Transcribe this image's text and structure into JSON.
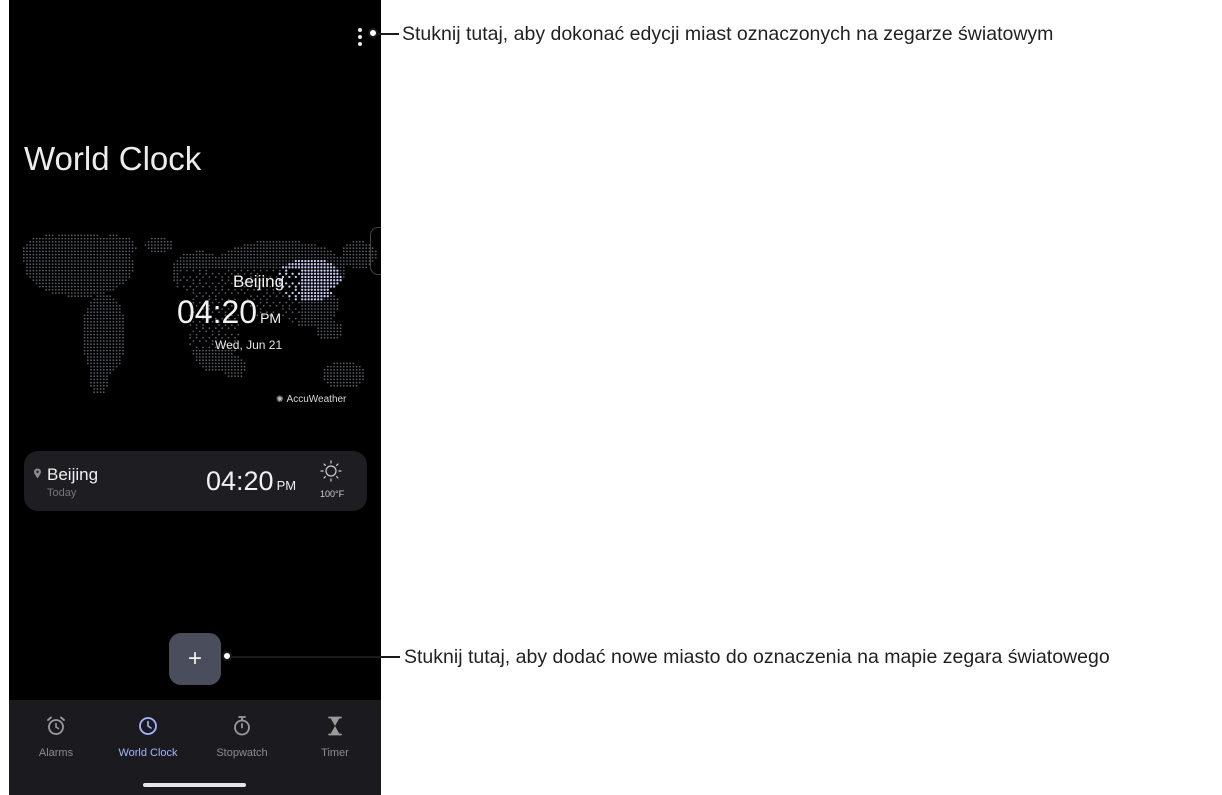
{
  "header": {
    "title": "World Clock",
    "menu_icon": "more-vert-icon"
  },
  "map": {
    "city": "Beijing",
    "time": "04:20",
    "ampm": "PM",
    "date": "Wed, Jun 21",
    "provider": "AccuWeather"
  },
  "card": {
    "city": "Beijing",
    "day": "Today",
    "time": "04:20",
    "ampm": "PM",
    "temperature": "100°F",
    "weather_icon": "sun-icon"
  },
  "fab": {
    "label": "+"
  },
  "nav": {
    "items": [
      {
        "label": "Alarms",
        "icon": "alarm-icon",
        "active": false
      },
      {
        "label": "World Clock",
        "icon": "clock-icon",
        "active": true
      },
      {
        "label": "Stopwatch",
        "icon": "stopwatch-icon",
        "active": false
      },
      {
        "label": "Timer",
        "icon": "hourglass-icon",
        "active": false
      }
    ],
    "active_color": "#a6b4ff"
  },
  "annotations": {
    "menu": "Stuknij tutaj, aby dokonać edycji miast oznaczonych na zegarze światowym",
    "add": "Stuknij tutaj, aby dodać nowe miasto do oznaczenia na mapie zegara światowego"
  }
}
